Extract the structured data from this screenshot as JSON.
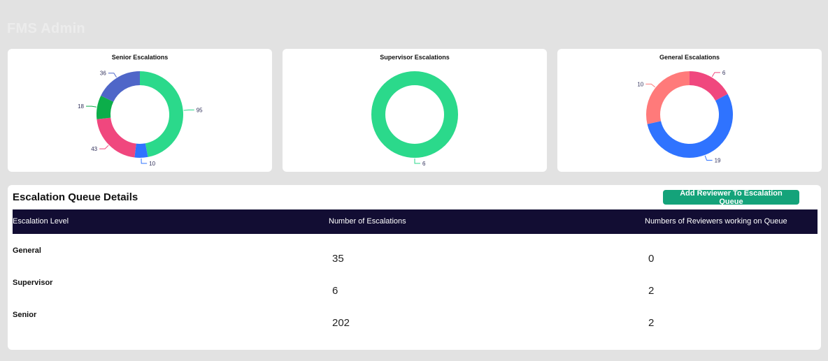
{
  "app": {
    "title": "FMS Admin"
  },
  "charts": {
    "senior": {
      "title": "Senior Escalations"
    },
    "supervisor": {
      "title": "Supervisor Escalations"
    },
    "general": {
      "title": "General Escalations"
    }
  },
  "chart_data": [
    {
      "type": "pie",
      "title": "Senior Escalations",
      "labels": [
        "95",
        "10",
        "43",
        "18",
        "36"
      ],
      "values": [
        95,
        10,
        43,
        18,
        36
      ],
      "colors": [
        "#2bd98b",
        "#2f73ff",
        "#f0477e",
        "#0cae4a",
        "#4f66c8"
      ]
    },
    {
      "type": "pie",
      "title": "Supervisor Escalations",
      "labels": [
        "6"
      ],
      "values": [
        6
      ],
      "colors": [
        "#2bd98b"
      ]
    },
    {
      "type": "pie",
      "title": "General Escalations",
      "labels": [
        "6",
        "19",
        "10"
      ],
      "values": [
        6,
        19,
        10
      ],
      "colors": [
        "#f0477e",
        "#2f73ff",
        "#ff7a7a"
      ]
    }
  ],
  "queue": {
    "title": "Escalation Queue Details",
    "add_button": "Add Reviewer To Escalation Queue",
    "columns": [
      "Escalation Level",
      "Number of Escalations",
      "Numbers of Reviewers working on Queue"
    ],
    "rows": [
      {
        "level": "General",
        "escalations": "35",
        "reviewers": "0"
      },
      {
        "level": "Supervisor",
        "escalations": "6",
        "reviewers": "2"
      },
      {
        "level": "Senior",
        "escalations": "202",
        "reviewers": "2"
      }
    ]
  }
}
